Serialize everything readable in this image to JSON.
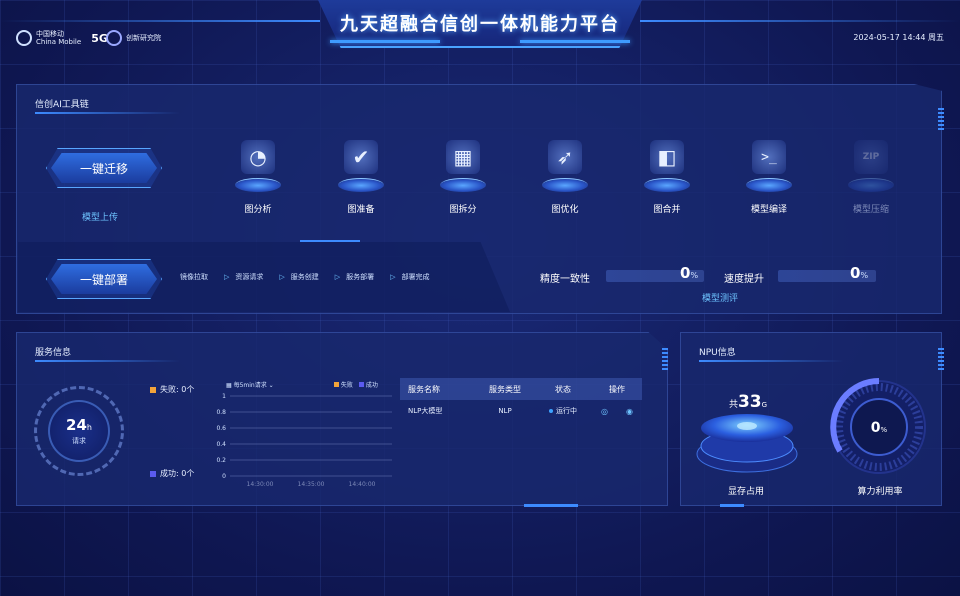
{
  "header": {
    "title": "九天超融合信创一体机能力平台",
    "logo1_cn": "中国移动",
    "logo1_en": "China Mobile",
    "logo1_5g": "5G",
    "logo2": "创新研究院",
    "datetime": "2024-05-17 14:44 周五"
  },
  "toolchain": {
    "title": "信创AI工具链",
    "migrate_button": "一键迁移",
    "upload_label": "模型上传",
    "tools": [
      {
        "label": "图分析",
        "icon": "pie-chart-icon",
        "enabled": true
      },
      {
        "label": "图准备",
        "icon": "check-icon",
        "enabled": true
      },
      {
        "label": "图拆分",
        "icon": "grid-icon",
        "enabled": true
      },
      {
        "label": "图优化",
        "icon": "rocket-icon",
        "enabled": true
      },
      {
        "label": "图合并",
        "icon": "merge-icon",
        "enabled": true
      },
      {
        "label": "模型编译",
        "icon": "terminal-icon",
        "enabled": true
      },
      {
        "label": "模型压缩",
        "icon": "zip-icon",
        "enabled": false
      }
    ],
    "deploy_button": "一键部署",
    "deploy_steps": [
      "镜像拉取",
      "资源请求",
      "服务创建",
      "服务部署",
      "部署完成"
    ],
    "accuracy_label": "精度一致性",
    "accuracy_value": "0",
    "accuracy_unit": "%",
    "speed_label": "速度提升",
    "speed_value": "0",
    "speed_unit": "%",
    "eval_label": "模型测评"
  },
  "service": {
    "title": "服务信息",
    "ring_value": "24",
    "ring_value_unit": "h",
    "ring_label": "请求",
    "fail_label": "失败: 0个",
    "success_label": "成功: 0个",
    "chart_dropdown": "每5min请求",
    "colors": {
      "fail": "#f2a33a",
      "success": "#5b5bf0"
    }
  },
  "chart_data": {
    "type": "line",
    "title": "",
    "xlabel": "",
    "ylabel": "",
    "x": [
      "14:30:00",
      "14:35:00",
      "14:40:00"
    ],
    "series": [
      {
        "name": "失败",
        "values": []
      },
      {
        "name": "成功",
        "values": []
      }
    ],
    "yticks": [
      "0",
      "0.2",
      "0.4",
      "0.6",
      "0.8",
      "1"
    ],
    "ylim": [
      0,
      1
    ],
    "grid": true,
    "legend": "top-right"
  },
  "table": {
    "headers": [
      "服务名称",
      "服务类型",
      "状态",
      "操作"
    ],
    "rows": [
      {
        "name": "NLP大模型",
        "type": "NLP",
        "status": "运行中",
        "ops": [
          "◎",
          "◉"
        ]
      }
    ]
  },
  "npu": {
    "title": "NPU信息",
    "total_prefix": "共",
    "total_value": "33",
    "total_unit": "G",
    "memory_label": "显存占用",
    "util_value": "0",
    "util_unit": "%",
    "util_label": "算力利用率"
  }
}
